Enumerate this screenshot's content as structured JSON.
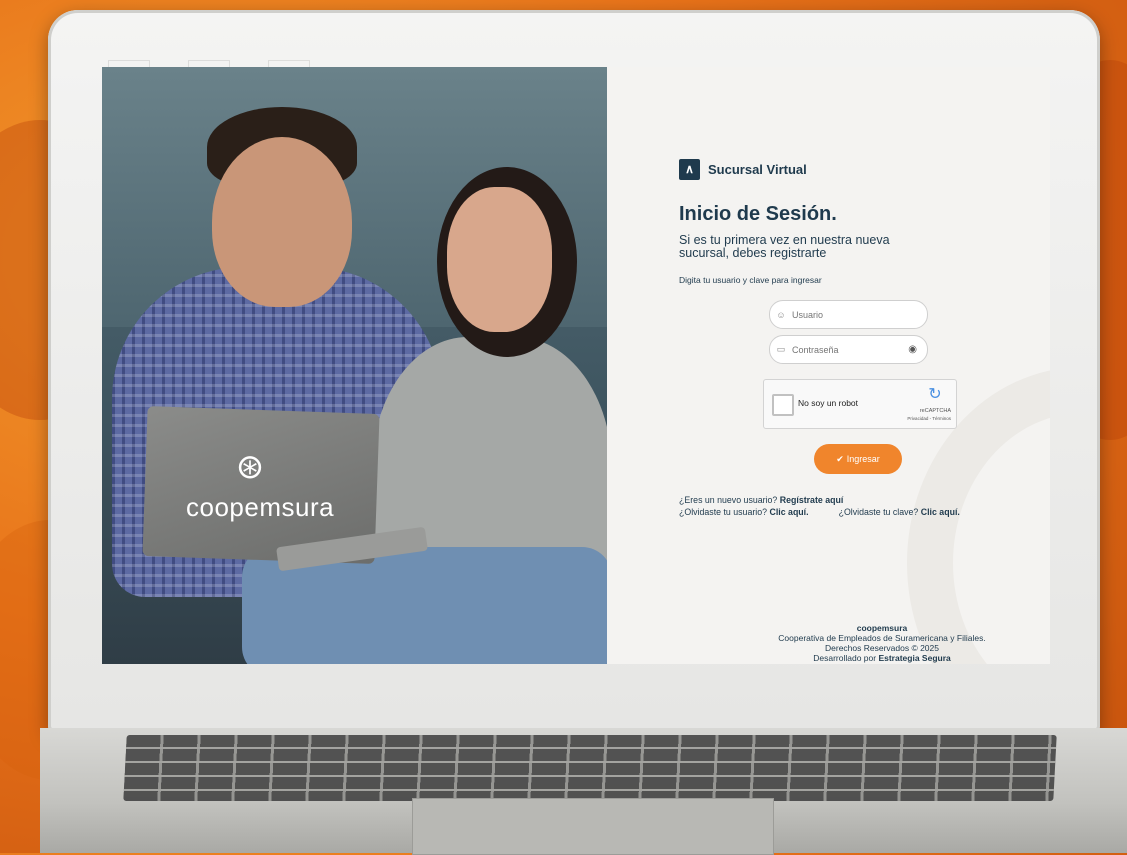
{
  "colors": {
    "brand_navy": "#1f3a4d",
    "accent_orange": "#f0852c",
    "panel_bg": "#f4f3f1"
  },
  "photo": {
    "brand_wordmark": "coopemsura"
  },
  "header": {
    "logo_icon": "chart-wave-icon",
    "logo_text": "Sucursal Virtual"
  },
  "login": {
    "title": "Inicio de Sesión.",
    "subtitle": "Si es tu primera vez en nuestra nueva sucursal, debes registrarte",
    "hint": "Digita tu usuario y clave para ingresar",
    "username": {
      "placeholder": "Usuario",
      "value": ""
    },
    "password": {
      "placeholder": "Contraseña",
      "value": ""
    },
    "captcha": {
      "label": "No soy un robot",
      "brand": "reCAPTCHA",
      "terms": "Privacidad - Términos"
    },
    "submit_label": "Ingresar"
  },
  "links": {
    "new_user_prefix": "¿Eres un nuevo usuario? ",
    "new_user_link": "Regístrate aquí",
    "forgot_user_prefix": "¿Olvidaste tu usuario? ",
    "forgot_user_link": "Clic aquí.",
    "forgot_pass_prefix": "¿Olvidaste tu clave? ",
    "forgot_pass_link": "Clic aquí."
  },
  "footer": {
    "brand": "coopemsura",
    "line1": "Cooperativa de Empleados de Suramericana y Filiales.",
    "line2": "Derechos Reservados © 2025",
    "line3_prefix": "Desarrollado por ",
    "line3_link": "Estrategia Segura"
  }
}
